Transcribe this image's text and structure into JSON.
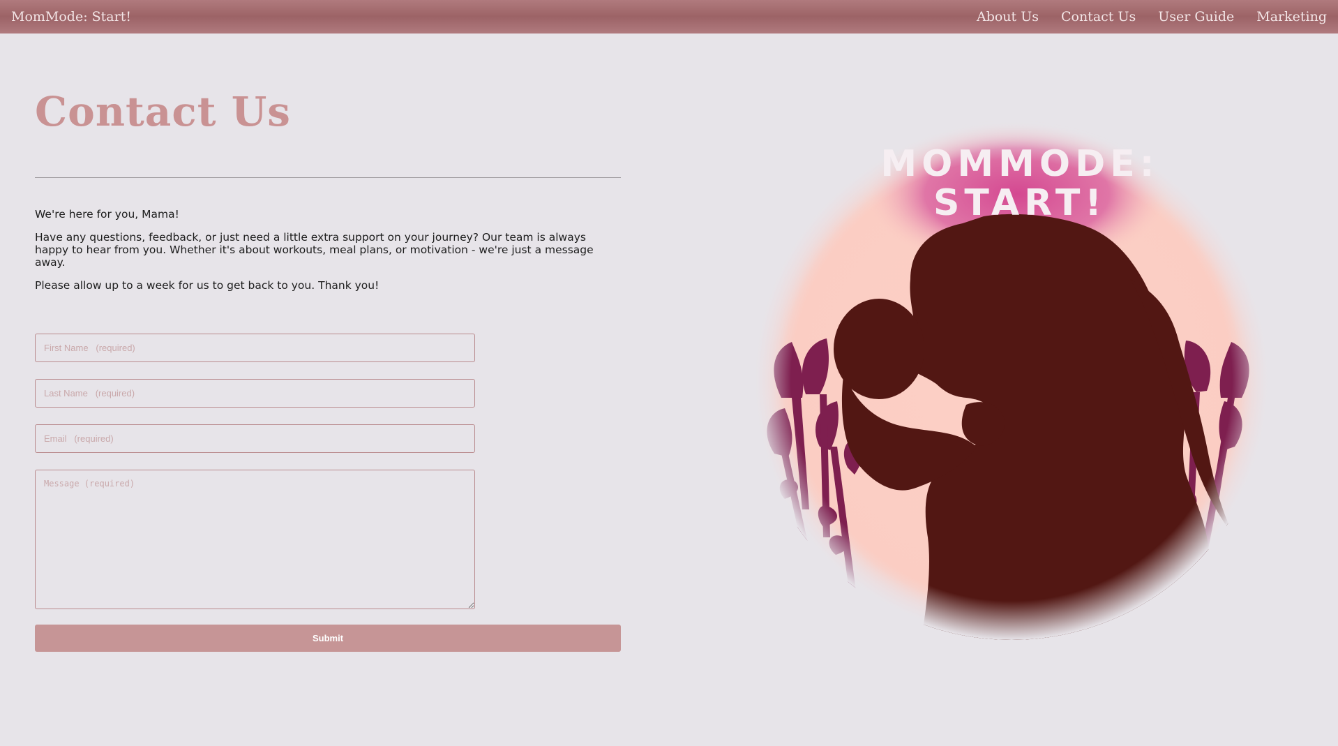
{
  "nav": {
    "brand": "MomMode: Start!",
    "links": [
      {
        "label": "About Us"
      },
      {
        "label": "Contact Us"
      },
      {
        "label": "User Guide"
      },
      {
        "label": "Marketing"
      }
    ]
  },
  "page": {
    "title": "Contact Us",
    "paragraphs": [
      "We're here for you, Mama!",
      "Have any questions, feedback, or just need a little extra support on your journey? Our team is always happy to hear from you. Whether it's about workouts, meal plans, or motivation - we're just a message away.",
      "Please allow up to a week for us to get back to you. Thank you!"
    ]
  },
  "form": {
    "first_name": {
      "value": "",
      "placeholder": "First Name   (required)"
    },
    "last_name": {
      "value": "",
      "placeholder": "Last Name   (required)"
    },
    "email": {
      "value": "",
      "placeholder": "Email   (required)"
    },
    "message": {
      "value": "",
      "placeholder": "Message (required)"
    },
    "submit_label": "Submit"
  },
  "logo": {
    "line1": "MOMMODE:",
    "line2": "START!"
  },
  "colors": {
    "nav_bg": "#9c6366",
    "title": "#c99293",
    "submit_bg": "#c69596",
    "page_bg": "#e7e4e9",
    "silhouette": "#521713",
    "flowers": "#7e1f4f",
    "logo_circle": "#fcd0c6",
    "logo_glow": "#d2418e"
  }
}
